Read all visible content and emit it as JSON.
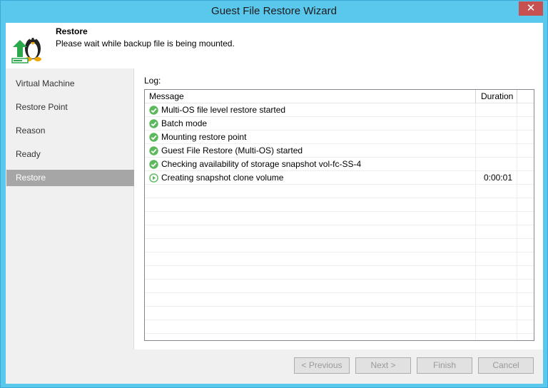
{
  "window": {
    "title": "Guest File Restore Wizard",
    "close_glyph": "✕"
  },
  "header": {
    "title": "Restore",
    "subtitle": "Please wait while backup file is being mounted."
  },
  "nav": {
    "items": [
      {
        "label": "Virtual Machine",
        "active": false
      },
      {
        "label": "Restore Point",
        "active": false
      },
      {
        "label": "Reason",
        "active": false
      },
      {
        "label": "Ready",
        "active": false
      },
      {
        "label": "Restore",
        "active": true
      }
    ]
  },
  "log": {
    "label": "Log:",
    "columns": {
      "message": "Message",
      "duration": "Duration"
    },
    "rows": [
      {
        "status": "success",
        "icon": "check-circle-icon",
        "message": "Multi-OS file level restore started",
        "duration": ""
      },
      {
        "status": "success",
        "icon": "check-circle-icon",
        "message": "Batch mode",
        "duration": ""
      },
      {
        "status": "success",
        "icon": "check-circle-icon",
        "message": "Mounting restore point",
        "duration": ""
      },
      {
        "status": "success",
        "icon": "check-circle-icon",
        "message": "Guest File Restore (Multi-OS) started",
        "duration": ""
      },
      {
        "status": "success",
        "icon": "check-circle-icon",
        "message": "Checking availability of storage snapshot vol-fc-SS-4",
        "duration": ""
      },
      {
        "status": "running",
        "icon": "play-circle-icon",
        "message": "Creating snapshot clone volume",
        "duration": "0:00:01"
      }
    ],
    "empty_row_count": 12
  },
  "footer": {
    "previous_label": "< Previous",
    "next_label": "Next >",
    "finish_label": "Finish",
    "cancel_label": "Cancel"
  },
  "colors": {
    "titlebar": "#5ac8ed",
    "success": "#5cb85c",
    "active_nav": "#a6a6a6"
  }
}
